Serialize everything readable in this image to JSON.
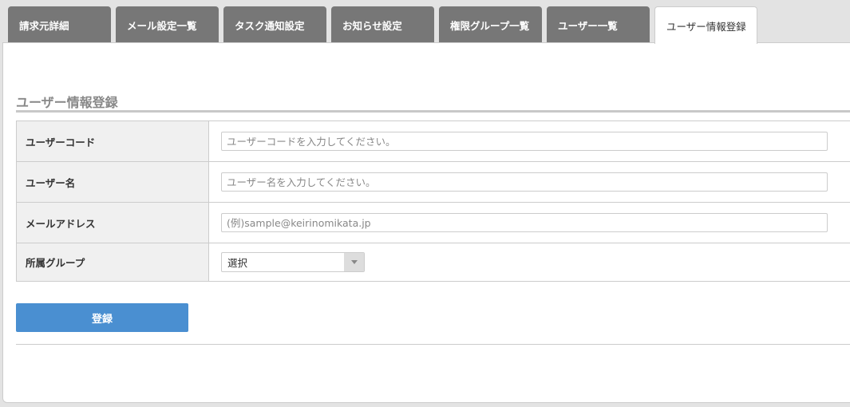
{
  "tabs": [
    {
      "label": "請求元詳細"
    },
    {
      "label": "メール設定一覧"
    },
    {
      "label": "タスク通知設定"
    },
    {
      "label": "お知らせ設定"
    },
    {
      "label": "権限グループ一覧"
    },
    {
      "label": "ユーザー一覧"
    },
    {
      "label": "ユーザー情報登録",
      "active": true
    }
  ],
  "section": {
    "title": "ユーザー情報登録"
  },
  "form": {
    "user_code": {
      "label": "ユーザーコード",
      "placeholder": "ユーザーコードを入力してください。"
    },
    "user_name": {
      "label": "ユーザー名",
      "placeholder": "ユーザー名を入力してください。"
    },
    "email": {
      "label": "メールアドレス",
      "placeholder": "(例)sample@keirinomikata.jp"
    },
    "group": {
      "label": "所属グループ",
      "selected": "選択"
    }
  },
  "submit_label": "登録"
}
